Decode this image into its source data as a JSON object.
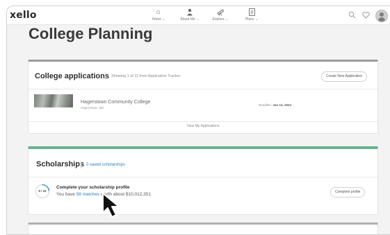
{
  "app": {
    "logo": "xello"
  },
  "nav": [
    {
      "label": "Home ⌄",
      "icon": "home-icon"
    },
    {
      "label": "About Me ⌄",
      "icon": "person-icon"
    },
    {
      "label": "Explore ⌄",
      "icon": "telescope-icon"
    },
    {
      "label": "Plans ⌄",
      "icon": "document-icon"
    }
  ],
  "header_icons": [
    "search-icon",
    "heart-icon",
    "avatar"
  ],
  "page": {
    "title": "College Planning"
  },
  "applications": {
    "title": "College applications",
    "subtitle": "Showing 1 of 11 from Application Tracker",
    "create_button": "Create New Application",
    "item": {
      "name": "Hagerstown Community College",
      "location": "Hagerstown, MD",
      "deadline_label": "Deadline:",
      "deadline_value": "Jun 13, 2024"
    },
    "view_link": "View My Applications"
  },
  "scholarships": {
    "title": "Scholarships",
    "saved_link": "0 saved scholarships",
    "progress_text": "5 / 22",
    "progress_fraction": 0.227,
    "accent_color": "#62b58f",
    "progress_color": "#4a9fd8",
    "profile_heading": "Complete your scholarship profile",
    "profile_prefix": "You have",
    "matches_link": "58 matches",
    "profile_suffix": "worth about $10,012,351",
    "complete_button": "Complete profile"
  }
}
